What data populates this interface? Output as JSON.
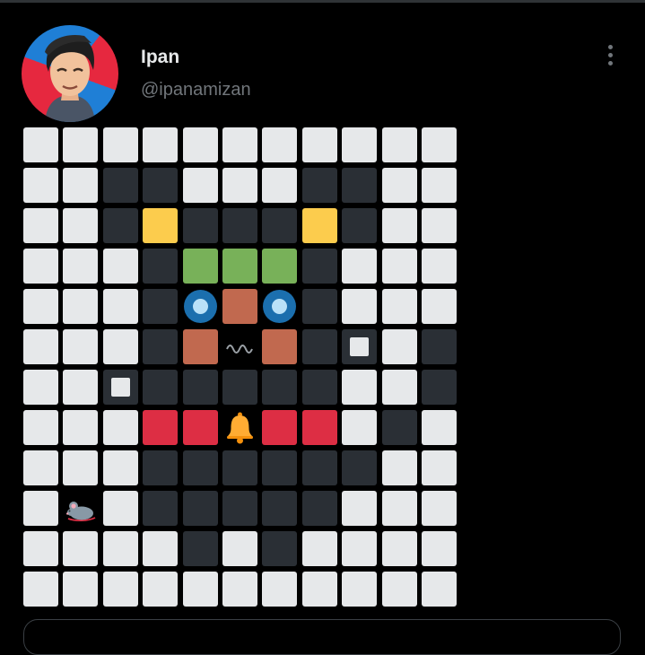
{
  "post": {
    "display_name": "Ipan",
    "handle": "@ipanamizan"
  },
  "icons": {
    "more": "more-options-icon",
    "avatar": "cartoon-portrait-avatar"
  },
  "colors": {
    "background": "#000000",
    "white_tile": "#e6e8ea",
    "dark_tile": "#2a2f35",
    "yellow": "#fccc4d",
    "green": "#78b159",
    "orange": "#c1694f",
    "red": "#dd2e44",
    "blue": "#1b6fae"
  },
  "emoji_grid": {
    "legend": {
      "w": "white-square",
      "d": "black-square",
      "y": "yellow-square",
      "g": "green-square",
      "o": "brown-square",
      "r": "red-square",
      "s": "white-small-square-on-black",
      "e": "blue-eye-circle",
      "v": "wavy-mouth",
      "b": "bell",
      "m": "mouse"
    },
    "rows": [
      [
        "w",
        "w",
        "w",
        "w",
        "w",
        "w",
        "w",
        "w",
        "w",
        "w",
        "w"
      ],
      [
        "w",
        "w",
        "d",
        "d",
        "w",
        "w",
        "w",
        "d",
        "d",
        "w",
        "w"
      ],
      [
        "w",
        "w",
        "d",
        "y",
        "d",
        "d",
        "d",
        "y",
        "d",
        "w",
        "w"
      ],
      [
        "w",
        "w",
        "w",
        "d",
        "g",
        "g",
        "g",
        "d",
        "w",
        "w",
        "w"
      ],
      [
        "w",
        "w",
        "w",
        "d",
        "e",
        "o",
        "e",
        "d",
        "w",
        "w",
        "w"
      ],
      [
        "w",
        "w",
        "w",
        "d",
        "o",
        "v",
        "o",
        "d",
        "s",
        "w",
        "d"
      ],
      [
        "w",
        "w",
        "s",
        "d",
        "d",
        "d",
        "d",
        "d",
        "w",
        "w",
        "d"
      ],
      [
        "w",
        "w",
        "w",
        "r",
        "r",
        "b",
        "r",
        "r",
        "w",
        "d",
        "w"
      ],
      [
        "w",
        "w",
        "w",
        "d",
        "d",
        "d",
        "d",
        "d",
        "d",
        "w",
        "w"
      ],
      [
        "w",
        "m",
        "w",
        "d",
        "d",
        "d",
        "d",
        "d",
        "w",
        "w",
        "w"
      ],
      [
        "w",
        "w",
        "w",
        "w",
        "d",
        "w",
        "d",
        "w",
        "w",
        "w",
        "w"
      ],
      [
        "w",
        "w",
        "w",
        "w",
        "w",
        "w",
        "w",
        "w",
        "w",
        "w",
        "w"
      ]
    ]
  }
}
